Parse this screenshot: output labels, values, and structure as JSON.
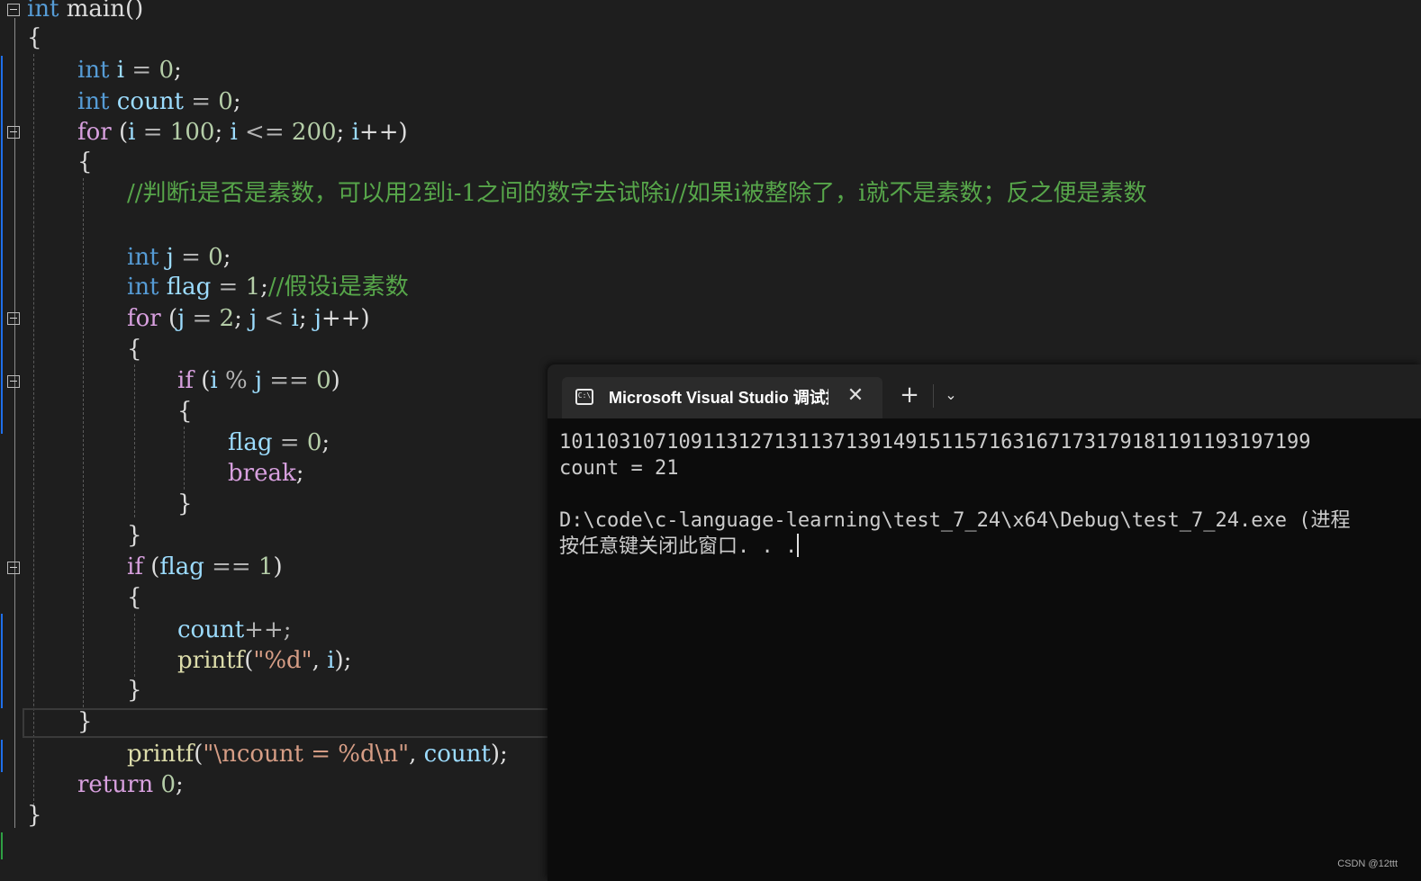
{
  "code": {
    "l1_kw": "int",
    "l1_rest": " main()",
    "l2": "{",
    "l3_kw": "int",
    "l3_var": " i",
    "l3_op": " = ",
    "l3_num": "0",
    "l3_end": ";",
    "l4_kw": "int",
    "l4_var": " count",
    "l4_op": " = ",
    "l4_num": "0",
    "l4_end": ";",
    "l5_kw": "for",
    "l5_a": " (",
    "l5_v1": "i",
    "l5_b": " = ",
    "l5_n1": "100",
    "l5_c": "; ",
    "l5_v2": "i",
    "l5_d": " <= ",
    "l5_n2": "200",
    "l5_e": "; ",
    "l5_v3": "i",
    "l5_f": "++)",
    "l6": "{",
    "l7_cmt": "//判断i是否是素数，可以用2到i-1之间的数字去试除i//如果i被整除了，i就不是素数；反之便是素数",
    "l8_kw": "int",
    "l8_var": " j",
    "l8_op": " = ",
    "l8_num": "0",
    "l8_end": ";",
    "l9_kw": "int",
    "l9_var": " flag",
    "l9_op": " = ",
    "l9_num": "1",
    "l9_end": ";",
    "l9_cmt": "//假设i是素数",
    "l10_kw": "for",
    "l10_a": " (",
    "l10_v1": "j",
    "l10_b": " = ",
    "l10_n1": "2",
    "l10_c": "; ",
    "l10_v2": "j",
    "l10_d": " < ",
    "l10_v3": "i",
    "l10_e": "; ",
    "l10_v4": "j",
    "l10_f": "++)",
    "l11": "{",
    "l12_kw": "if",
    "l12_a": " (",
    "l12_v1": "i",
    "l12_b": " % ",
    "l12_v2": "j",
    "l12_c": " == ",
    "l12_n": "0",
    "l12_d": ")",
    "l13": "{",
    "l14_var": "flag",
    "l14_op": " = ",
    "l14_num": "0",
    "l14_end": ";",
    "l15_kw": "break",
    "l15_end": ";",
    "l16": "}",
    "l17": "}",
    "l18_kw": "if",
    "l18_a": " (",
    "l18_v": "flag",
    "l18_b": " == ",
    "l18_n": "1",
    "l18_c": ")",
    "l19": "{",
    "l20_var": "count",
    "l20_op": "++;",
    "l21_fn": "printf",
    "l21_a": "(",
    "l21_str": "\"%d\"",
    "l21_b": ", ",
    "l21_v": "i",
    "l21_c": ");",
    "l22": "}",
    "l23": "}",
    "l24_fn": "printf",
    "l24_a": "(",
    "l24_str": "\"\\ncount = %d\\n\"",
    "l24_b": ", ",
    "l24_v": "count",
    "l24_c": ");",
    "l25_kw": "return",
    "l25_num": " 0",
    "l25_end": ";",
    "l26": "}"
  },
  "terminal": {
    "tab_icon": "C:\\",
    "tab_title": "Microsoft Visual Studio 调试控制台",
    "tab_close": "✕",
    "new_tab": "+",
    "dropdown": "⌄",
    "output_line1": "101103107109113127131137139149151157163167173179181191193197199",
    "output_line2": "count = 21",
    "output_line3": "D:\\code\\c-language-learning\\test_7_24\\x64\\Debug\\test_7_24.exe (进程",
    "output_line4": "按任意键关闭此窗口. . ."
  },
  "watermark": "CSDN @12ttt",
  "colors": {
    "keyword": "#569cd6",
    "control": "#d8a0df",
    "number": "#b5cea8",
    "variable": "#9cdcfe",
    "function": "#dcdcaa",
    "string": "#d69d85",
    "comment": "#57a64a"
  }
}
